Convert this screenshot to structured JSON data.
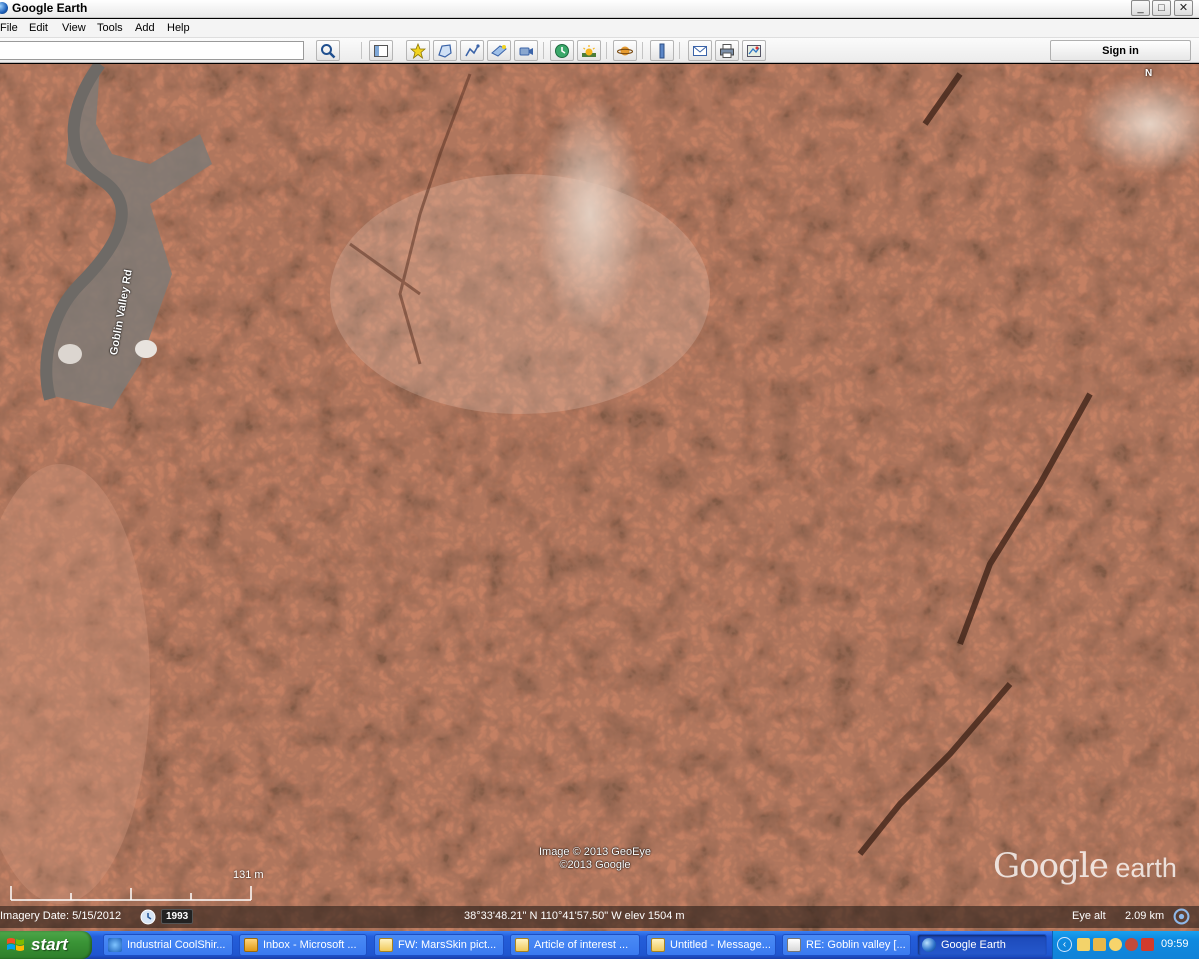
{
  "window": {
    "title": "Google Earth",
    "controls": {
      "minimize": "_",
      "maximize": "□",
      "close": "✕"
    }
  },
  "menu": {
    "items": [
      "File",
      "Edit",
      "View",
      "Tools",
      "Add",
      "Help"
    ]
  },
  "toolbar": {
    "search_value": "",
    "sign_in_label": "Sign in",
    "buttons": [
      "search-icon",
      "sidebar-toggle-icon",
      "placemark-icon",
      "polygon-icon",
      "path-icon",
      "image-overlay-icon",
      "record-tour-icon",
      "historical-imagery-icon",
      "sunlight-icon",
      "planets-icon",
      "ruler-icon",
      "email-icon",
      "print-icon",
      "view-in-maps-icon"
    ]
  },
  "map": {
    "road_label": "Goblin Valley Rd",
    "north_label": "N",
    "attribution_line1": "Image © 2013 GeoEye",
    "attribution_line2": "©2013 Google",
    "watermark_main": "Google",
    "watermark_sub": " earth",
    "scale_label": "131 m",
    "terrain_color": "#bf7c60"
  },
  "status": {
    "imagery_date": "Imagery Date: 5/15/2012",
    "historic_year": "1993",
    "coordinates": "38°33'48.21\" N 110°41'57.50\" W elev 1504 m",
    "eye_alt_label": "Eye alt",
    "eye_alt_value": "2.09 km"
  },
  "taskbar": {
    "start_label": "start",
    "tasks": [
      {
        "label": "Industrial CoolShir...",
        "icon": "ie-icon",
        "active": false
      },
      {
        "label": "Inbox - Microsoft ...",
        "icon": "outlook-icon",
        "active": false
      },
      {
        "label": "FW: MarsSkin pict...",
        "icon": "mail-icon",
        "active": false
      },
      {
        "label": "Article of interest ...",
        "icon": "mail-icon",
        "active": false
      },
      {
        "label": "Untitled - Message...",
        "icon": "mail-icon",
        "active": false
      },
      {
        "label": "RE: Goblin valley [...",
        "icon": "mail-reply-icon",
        "active": false
      },
      {
        "label": "Google Earth",
        "icon": "earth-icon",
        "active": true
      }
    ],
    "clock": "09:59"
  }
}
